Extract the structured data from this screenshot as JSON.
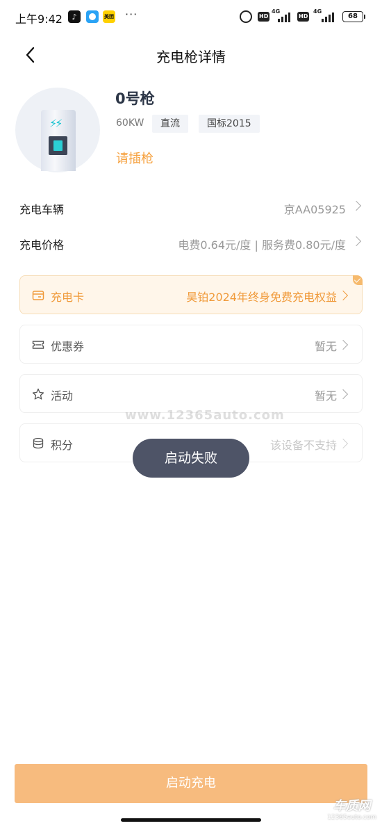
{
  "status_bar": {
    "time": "上午9:42",
    "dots": "···",
    "hd_label": "HD",
    "net_label": "4G",
    "battery": "68",
    "app_icons": [
      "tiktok-icon",
      "blue-app-icon",
      "meituan-icon"
    ]
  },
  "header": {
    "title": "充电枪详情",
    "back_icon": "chevron-left-icon"
  },
  "gun": {
    "name": "0号枪",
    "power": "60KW",
    "tags": [
      "直流",
      "国标2015"
    ],
    "status": "请插枪"
  },
  "info_rows": {
    "vehicle": {
      "label": "充电车辆",
      "value": "京AA05925"
    },
    "price": {
      "label": "充电价格",
      "value": "电费0.64元/度 | 服务费0.80元/度"
    }
  },
  "cards": {
    "charge_card": {
      "label": "充电卡",
      "value": "昊铂2024年终身免费充电权益",
      "icon": "card-icon"
    },
    "coupon": {
      "label": "优惠券",
      "value": "暂无",
      "icon": "ticket-icon"
    },
    "activity": {
      "label": "活动",
      "value": "暂无",
      "icon": "star-icon"
    },
    "points": {
      "label": "积分",
      "value": "该设备不支持",
      "icon": "coins-icon"
    }
  },
  "watermark": "www.12365auto.com",
  "toast": "启动失败",
  "bottom": {
    "start_label": "启动充电"
  },
  "logo": {
    "main": "车质网",
    "sub": "12365auto.com"
  },
  "colors": {
    "accent": "#f6a03d",
    "button": "#f7bb7e",
    "toast_bg": "#4e5467"
  }
}
